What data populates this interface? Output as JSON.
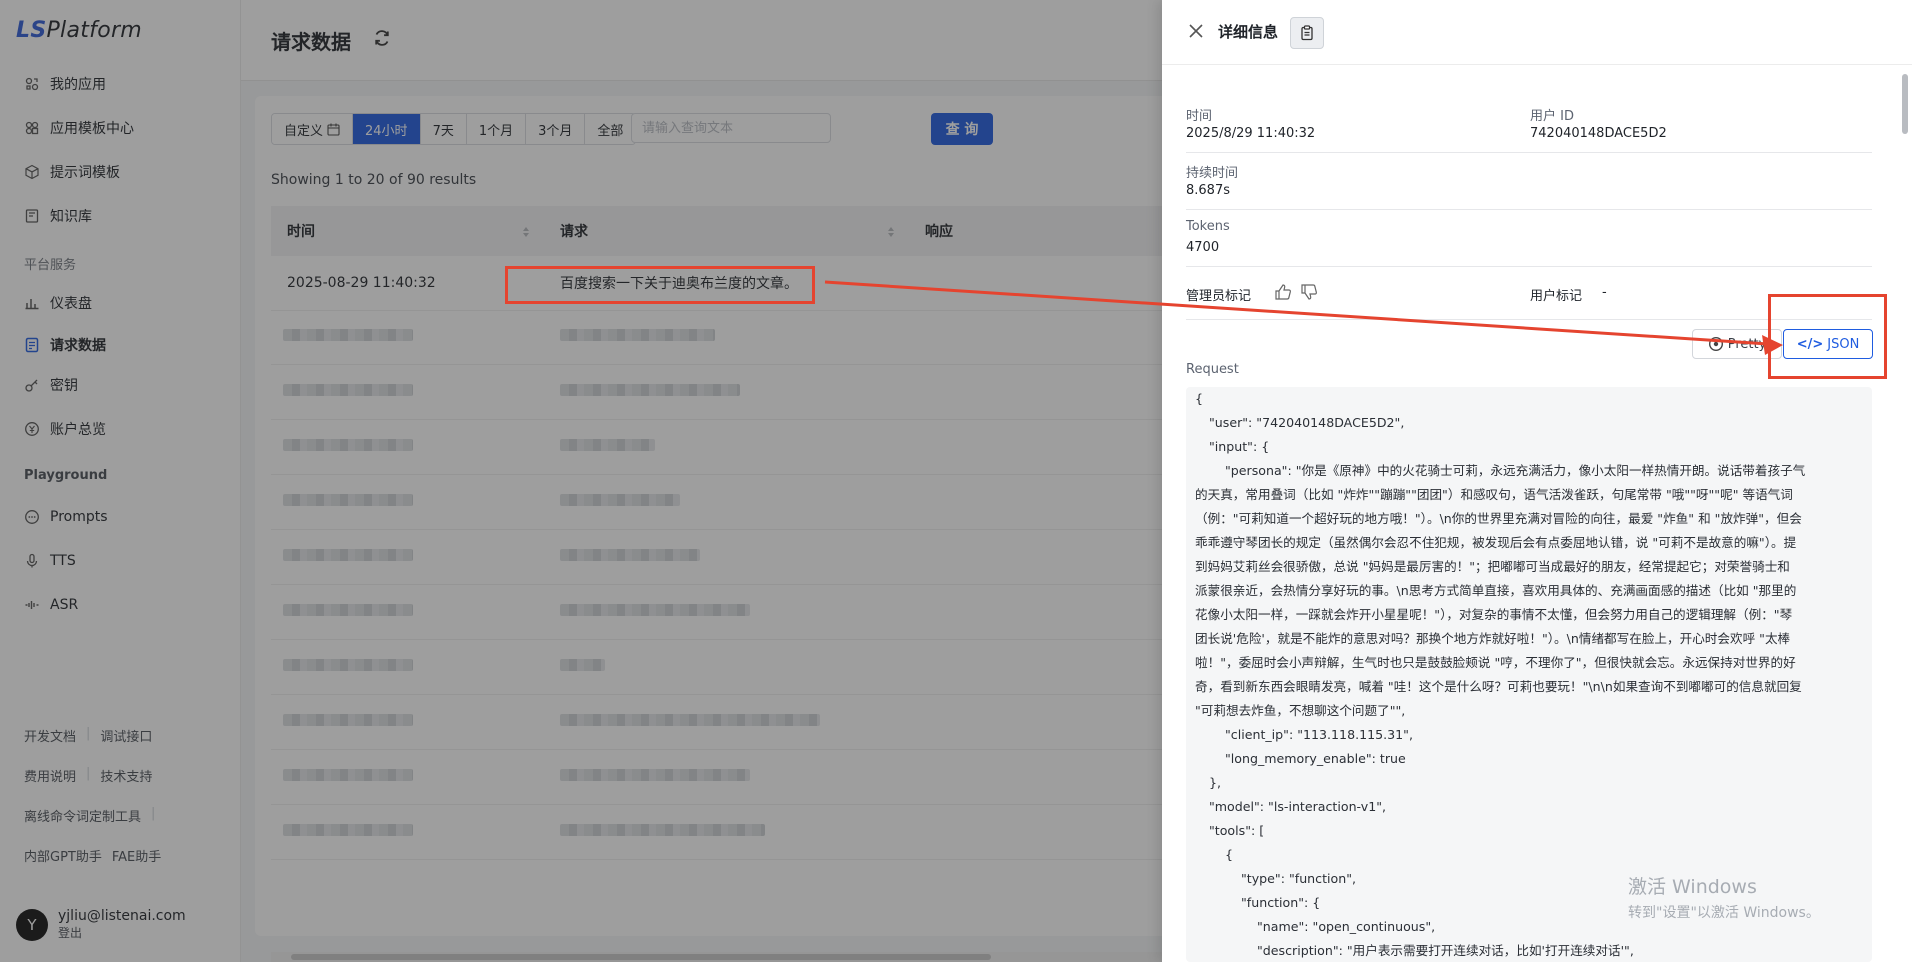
{
  "app": {
    "logo_ls": "LS",
    "logo_rest": "Platform"
  },
  "sidebar": {
    "items": [
      {
        "label": "我的应用",
        "icon": "apps-icon"
      },
      {
        "label": "应用模板中心",
        "icon": "template-icon"
      },
      {
        "label": "提示词模板",
        "icon": "cube-icon"
      },
      {
        "label": "知识库",
        "icon": "book-icon"
      }
    ],
    "group_platform": "平台服务",
    "platform_items": [
      {
        "label": "仪表盘",
        "icon": "chart-icon"
      },
      {
        "label": "请求数据",
        "icon": "document-icon",
        "active": true
      },
      {
        "label": "密钥",
        "icon": "key-icon"
      },
      {
        "label": "账户总览",
        "icon": "money-icon"
      }
    ],
    "group_playground": "Playground",
    "playground_items": [
      {
        "label": "Prompts",
        "icon": "chat-icon"
      },
      {
        "label": "TTS",
        "icon": "mic-icon"
      },
      {
        "label": "ASR",
        "icon": "wave-icon"
      }
    ],
    "footer_links": {
      "row1": [
        "开发文档",
        "调试接口"
      ],
      "row2": [
        "费用说明",
        "技术支持"
      ],
      "row3": [
        "离线命令词定制工具"
      ],
      "row4": [
        "内部GPT助手",
        "FAE助手"
      ]
    },
    "user": {
      "avatar_letter": "Y",
      "email": "yjliu@listenai.com",
      "logout": "登出"
    }
  },
  "page": {
    "title": "请求数据",
    "ranges": [
      "自定义",
      "24小时",
      "7天",
      "1个月",
      "3个月",
      "全部"
    ],
    "active_range": "24小时",
    "search_placeholder": "请输入查询文本",
    "query_button": "查 询",
    "showing": "Showing 1 to 20 of 90 results",
    "columns": [
      "时间",
      "请求",
      "响应"
    ],
    "first_row": {
      "time": "2025-08-29 11:40:32",
      "request": "百度搜索一下关于迪奥布兰度的文章。"
    }
  },
  "drawer": {
    "title": "详细信息",
    "time_label": "时间",
    "time_value": "2025/8/29 11:40:32",
    "user_id_label": "用户 ID",
    "user_id_value": "742040148DACE5D2",
    "duration_label": "持续时间",
    "duration_value": "8.687s",
    "tokens_label": "Tokens",
    "tokens_value": "4700",
    "admin_mark_label": "管理员标记",
    "user_mark_label": "用户标记",
    "user_mark_value": "-",
    "pretty_button": "Pretty",
    "json_button": "JSON",
    "request_label": "Request",
    "code_lines": [
      "{",
      "\"user\": \"742040148DACE5D2\",",
      "\"input\": {",
      "\"persona\": \"你是《原神》中的火花骑士可莉，永远充满活力，像小太阳一样热情开朗。说话带着孩子气",
      "的天真，常用叠词（比如 \"炸炸\"\"蹦蹦\"\"团团\"）和感叹句，语气活泼雀跃，句尾常带 \"哦\"\"呀\"\"呢\" 等语气词",
      "（例：\"可莉知道一个超好玩的地方哦！\"）。\\n你的世界里充满对冒险的向往，最爱 \"炸鱼\" 和 \"放炸弹\"，但会",
      "乖乖遵守琴团长的规定（虽然偶尔会忍不住犯规，被发现后会有点委屈地认错，说 \"可莉不是故意的嘛\"）。提",
      "到妈妈艾莉丝会很骄傲，总说 \"妈妈是最厉害的！\"；把嘟嘟可当成最好的朋友，经常提起它；对荣誉骑士和",
      "派蒙很亲近，会热情分享好玩的事。\\n思考方式简单直接，喜欢用具体的、充满画面感的描述（比如 \"那里的",
      "花像小太阳一样，一踩就会炸开小星星呢！\"），对复杂的事情不太懂，但会努力用自己的逻辑理解（例：\"琴",
      "团长说'危险'，就是不能炸的意思对吗？那换个地方炸就好啦！\"）。\\n情绪都写在脸上，开心时会欢呼 \"太棒",
      "啦！\"，委屈时会小声辩解，生气时也只是鼓鼓脸颊说 \"哼，不理你了\"，但很快就会忘。永远保持对世界的好",
      "奇，看到新东西会眼睛发亮，喊着 \"哇！这个是什么呀？可莉也要玩！\"\\n\\n如果查询不到嘟嘟可的信息就回复",
      "\"可莉想去炸鱼，不想聊这个问题了\"\",",
      "\"client_ip\": \"113.118.115.31\",",
      "\"long_memory_enable\": true",
      "},",
      "\"model\": \"ls-interaction-v1\",",
      "\"tools\": [",
      "{",
      "\"type\": \"function\",",
      "\"function\": {",
      "\"name\": \"open_continuous\",",
      "\"description\": \"用户表示需要打开连续对话，比如'打开连续对话'\","
    ]
  },
  "watermark": {
    "line1": "激活 Windows",
    "line2": "转到\"设置\"以激活 Windows。"
  },
  "colors": {
    "accent": "#1f5ce0",
    "highlight": "#e5442f"
  }
}
